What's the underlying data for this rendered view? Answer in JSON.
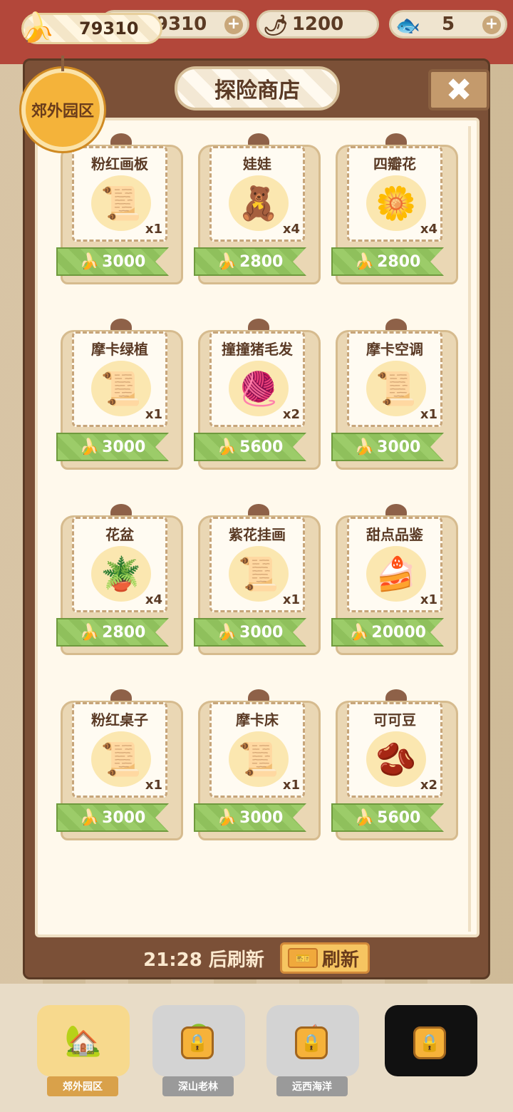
{
  "currencies": {
    "banana_main": "79310",
    "banana": "79310",
    "pepper": "1200",
    "fish": "5",
    "plus_symbol": "+"
  },
  "shop": {
    "title": "探险商店",
    "close_symbol": "✖",
    "area_badge": "郊外园区",
    "refresh_timer": "21:28 后刷新",
    "refresh_button": "刷新",
    "items": [
      {
        "name": "粉红画板",
        "icon": "blueprint-icon",
        "glyph": "📜",
        "qty": "x1",
        "price": "3000"
      },
      {
        "name": "娃娃",
        "icon": "doll-icon",
        "glyph": "🧸",
        "qty": "x4",
        "price": "2800"
      },
      {
        "name": "四瓣花",
        "icon": "flower-icon",
        "glyph": "🌼",
        "qty": "x4",
        "price": "2800"
      },
      {
        "name": "摩卡绿植",
        "icon": "blueprint-icon",
        "glyph": "📜",
        "qty": "x1",
        "price": "3000"
      },
      {
        "name": "撞撞猪毛发",
        "icon": "pig-hair-icon",
        "glyph": "🧶",
        "qty": "x2",
        "price": "5600"
      },
      {
        "name": "摩卡空调",
        "icon": "blueprint-icon",
        "glyph": "📜",
        "qty": "x1",
        "price": "3000"
      },
      {
        "name": "花盆",
        "icon": "flowerpot-icon",
        "glyph": "🪴",
        "qty": "x4",
        "price": "2800"
      },
      {
        "name": "紫花挂画",
        "icon": "blueprint-icon",
        "glyph": "📜",
        "qty": "x1",
        "price": "3000"
      },
      {
        "name": "甜点品鉴",
        "icon": "dessert-picture-icon",
        "glyph": "🍰",
        "qty": "x1",
        "price": "20000"
      },
      {
        "name": "粉红桌子",
        "icon": "blueprint-icon",
        "glyph": "📜",
        "qty": "x1",
        "price": "3000"
      },
      {
        "name": "摩卡床",
        "icon": "blueprint-icon",
        "glyph": "📜",
        "qty": "x1",
        "price": "3000"
      },
      {
        "name": "可可豆",
        "icon": "cocoa-bean-icon",
        "glyph": "🫘",
        "qty": "x2",
        "price": "5600"
      }
    ]
  },
  "regions": [
    {
      "label": "郊外园区",
      "locked": false
    },
    {
      "label": "深山老林",
      "locked": true
    },
    {
      "label": "远西海洋",
      "locked": true
    },
    {
      "label": "",
      "locked": true
    }
  ]
}
